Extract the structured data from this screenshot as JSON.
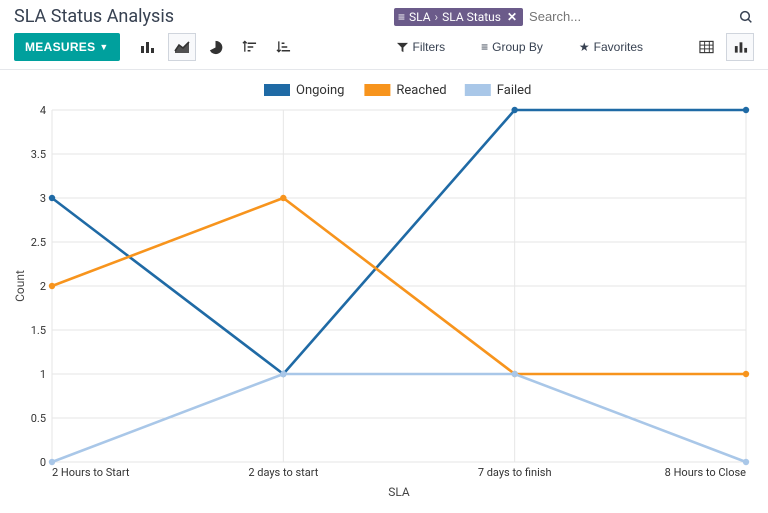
{
  "header": {
    "title": "SLA Status Analysis",
    "search_tag_prefix": "SLA",
    "search_tag_value": "SLA Status",
    "search_placeholder": "Search..."
  },
  "toolbar": {
    "measures_label": "MEASURES",
    "filters_label": "Filters",
    "groupby_label": "Group By",
    "favorites_label": "Favorites"
  },
  "chart_data": {
    "type": "line",
    "title": "",
    "xlabel": "SLA",
    "ylabel": "Count",
    "ylim": [
      0,
      4
    ],
    "yticks": [
      0,
      0.5,
      1,
      1.5,
      2,
      2.5,
      3,
      3.5,
      4
    ],
    "categories": [
      "2 Hours to Start",
      "2 days to start",
      "7 days to finish",
      "8 Hours to Close"
    ],
    "series": [
      {
        "name": "Ongoing",
        "color": "#1f6aa5",
        "values": [
          3,
          1,
          4,
          4
        ]
      },
      {
        "name": "Reached",
        "color": "#f7941d",
        "values": [
          2,
          3,
          1,
          1
        ]
      },
      {
        "name": "Failed",
        "color": "#a9c7e8",
        "values": [
          0,
          1,
          1,
          0
        ]
      }
    ]
  }
}
